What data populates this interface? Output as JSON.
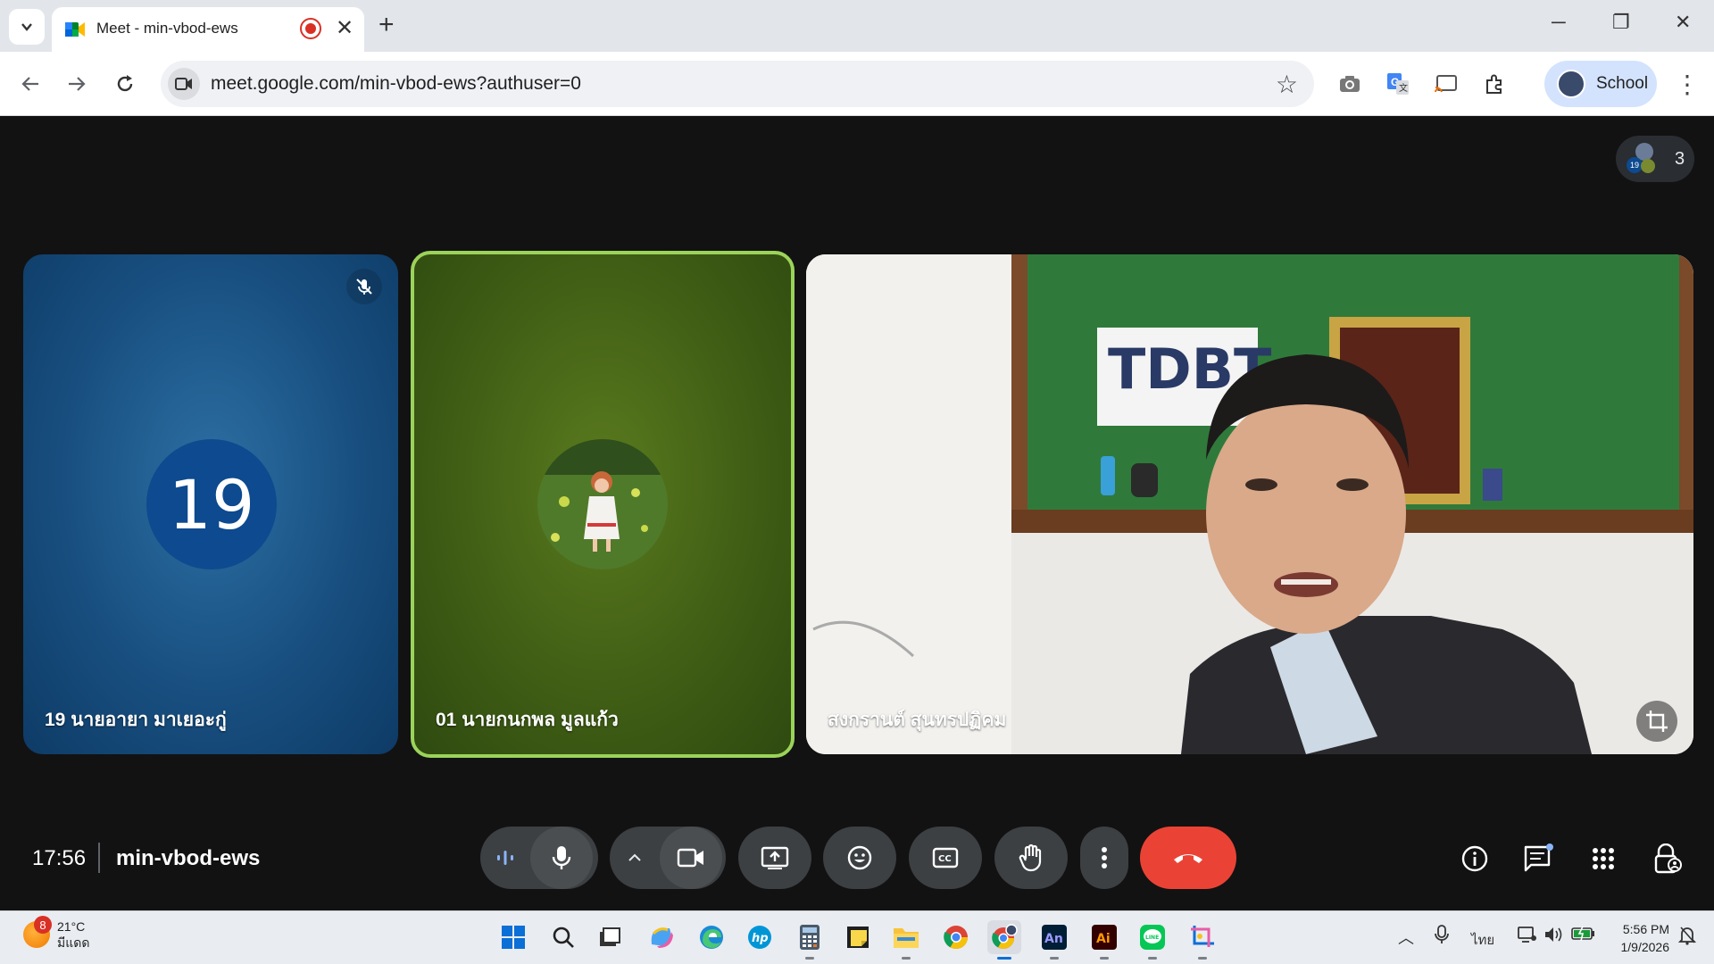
{
  "browser": {
    "tab_title": "Meet - min-vbod-ews",
    "url": "meet.google.com/min-vbod-ews?authuser=0",
    "profile_label": "School"
  },
  "meet": {
    "people_count": "3",
    "participants": [
      {
        "avatar_text": "19",
        "name": "19 นายอายา มาเยอะกู่",
        "muted": true
      },
      {
        "name": "01 นายกนกพล มูลแก้ว",
        "speaking": true
      },
      {
        "name": "สงกรานต์ สุนทรปฏิคม",
        "video": true
      }
    ],
    "time": "17:56",
    "meeting_code": "min-vbod-ews"
  },
  "taskbar": {
    "weather_badge": "8",
    "temperature": "21°C",
    "weather_desc": "มีแดด",
    "language": "ไทย",
    "clock_time": "5:56 PM",
    "clock_date": "1/9/2026"
  },
  "colors": {
    "end_call": "#ea4335",
    "active_speaker_border": "#9bd35a",
    "tile_blue": "#184f80",
    "tile_green": "#3e5c14"
  }
}
